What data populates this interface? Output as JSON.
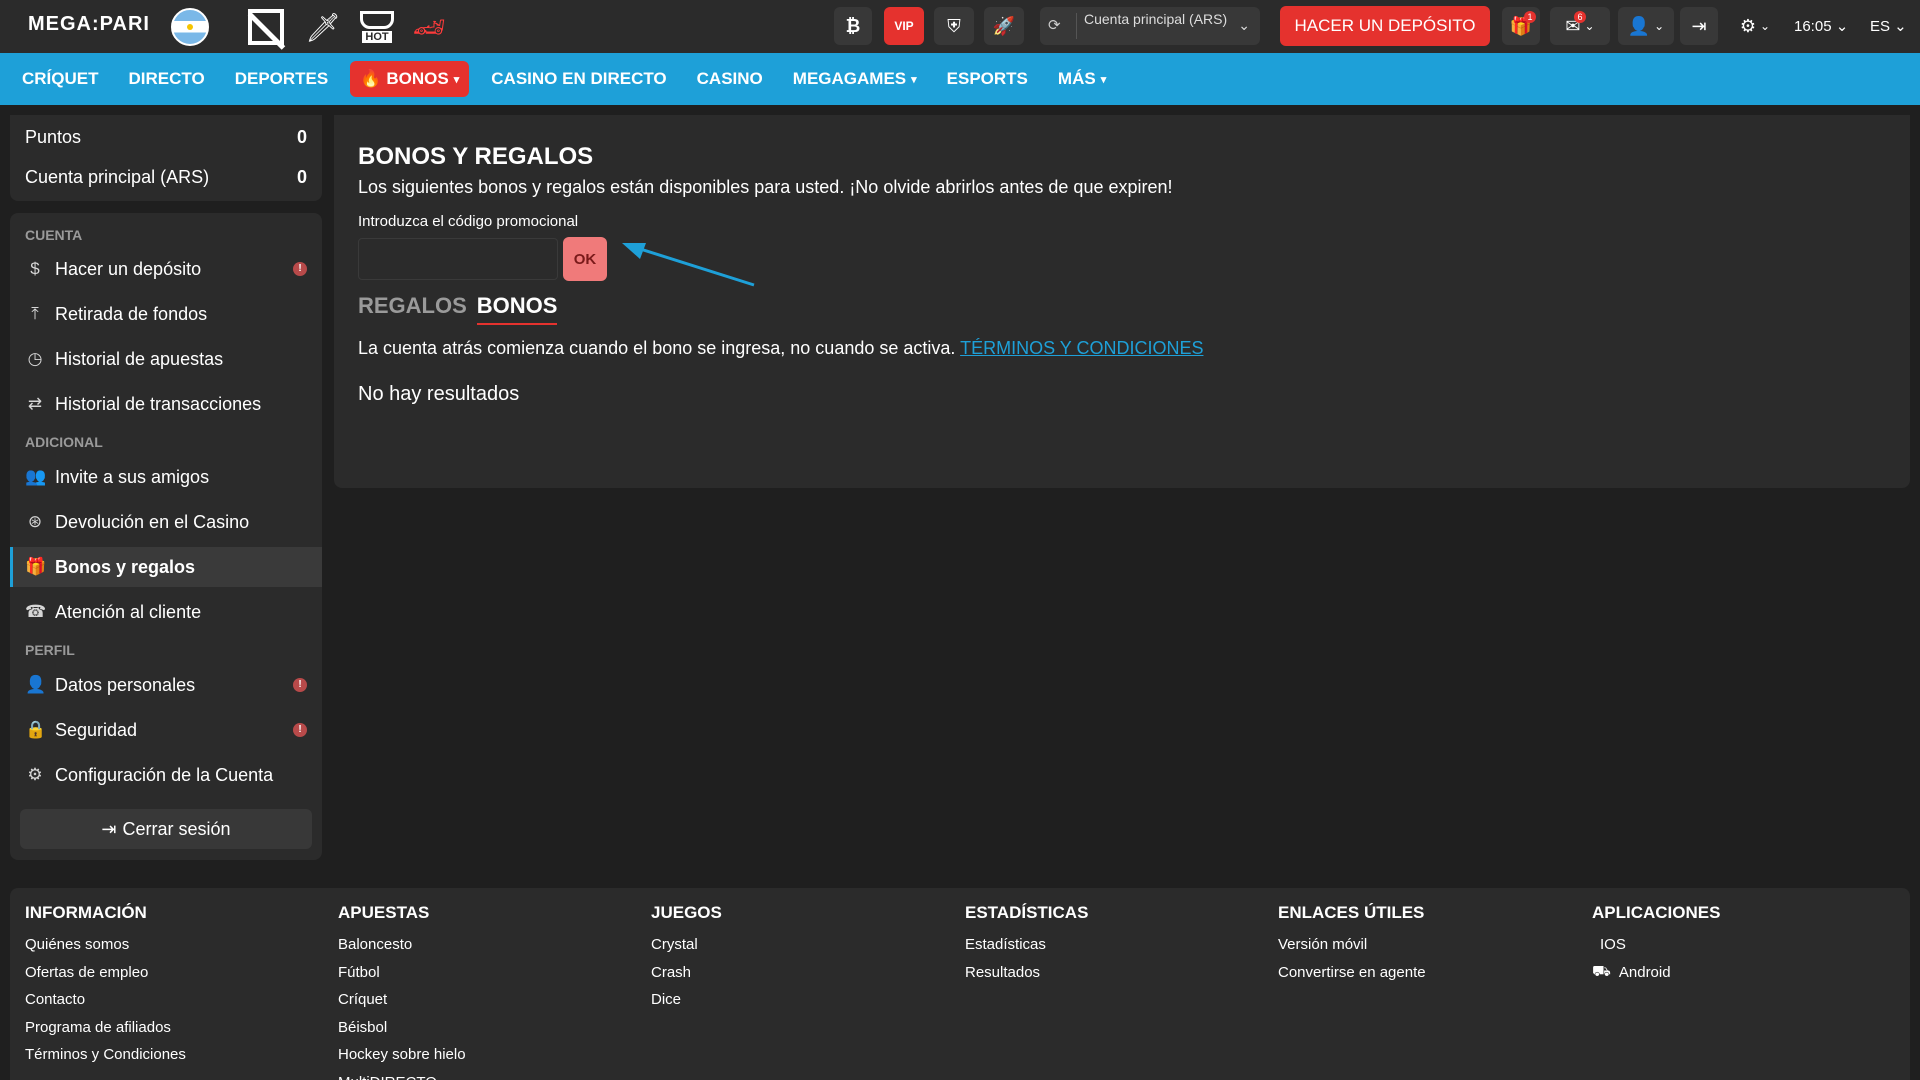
{
  "header": {
    "logo": "MEGA:PARI",
    "hot_label": "HOT",
    "vip_label": "VIP",
    "account_label": "Cuenta principal  (ARS)",
    "deposit_button": "HACER UN DEPÓSITO",
    "gift_badge": "1",
    "mail_badge": "6",
    "time": "16:05",
    "language": "ES"
  },
  "nav": {
    "items": [
      "CRÍQUET",
      "DIRECTO",
      "DEPORTES",
      "BONOS",
      "CASINO EN DIRECTO",
      "CASINO",
      "MEGAGAMES",
      "ESPORTS",
      "MÁS"
    ]
  },
  "summary": {
    "points_label": "Puntos",
    "points_value": "0",
    "account_label": "Cuenta principal (ARS)",
    "account_value": "0"
  },
  "sidebar": {
    "section_account": "CUENTA",
    "section_additional": "ADICIONAL",
    "section_profile": "PERFIL",
    "items": [
      "Hacer un depósito",
      "Retirada de fondos",
      "Historial de apuestas",
      "Historial de transacciones",
      "Invite a sus amigos",
      "Devolución en el Casino",
      "Bonos y regalos",
      "Atención al cliente",
      "Datos personales",
      "Seguridad",
      "Configuración de la Cuenta"
    ],
    "logout": "Cerrar sesión"
  },
  "main": {
    "title": "BONOS Y REGALOS",
    "subtitle": "Los siguientes bonos y regalos están disponibles para usted. ¡No olvide abrirlos antes de que expiren!",
    "promo_label": "Introduzca el código promocional",
    "promo_value": "",
    "ok_button": "OK",
    "tab_gifts": "REGALOS",
    "tab_bonuses": "BONOS",
    "notice": "La cuenta atrás comienza cuando el bono se ingresa, no cuando se activa.",
    "terms_link": "TÉRMINOS Y CONDICIONES",
    "empty": "No hay resultados"
  },
  "footer": {
    "columns": [
      {
        "title": "INFORMACIÓN",
        "links": [
          "Quiénes somos",
          "Ofertas de empleo",
          "Contacto",
          "Programa de afiliados",
          "Términos y Condiciones"
        ]
      },
      {
        "title": "APUESTAS",
        "links": [
          "Baloncesto",
          "Fútbol",
          "Críquet",
          "Béisbol",
          "Hockey sobre hielo",
          "MultiDIRECTO"
        ]
      },
      {
        "title": "JUEGOS",
        "links": [
          "Crystal",
          "Crash",
          "Dice"
        ]
      },
      {
        "title": "ESTADÍSTICAS",
        "links": [
          "Estadísticas",
          "Resultados"
        ]
      },
      {
        "title": "ENLACES ÚTILES",
        "links": [
          "Versión móvil",
          "Convertirse en agente"
        ]
      },
      {
        "title": "APLICACIONES",
        "links": [
          "IOS",
          "Android"
        ]
      }
    ]
  },
  "colors": {
    "accent_blue": "#1ea0d8",
    "accent_red": "#e5322e",
    "ok_button": "#f07a7a"
  }
}
